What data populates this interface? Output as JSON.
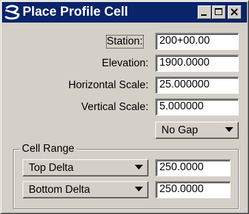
{
  "window": {
    "title": "Place Profile Cell",
    "icons": [
      "app-logo-icon",
      "minimize-icon",
      "maximize-icon",
      "close-icon"
    ]
  },
  "fields": {
    "station_label": "Station:",
    "station_value": "200+00.00",
    "elevation_label": "Elevation:",
    "elevation_value": "1900.0000",
    "horizontal_scale_label": "Horizontal Scale:",
    "horizontal_scale_value": "25.000000",
    "vertical_scale_label": "Vertical Scale:",
    "vertical_scale_value": "5.000000"
  },
  "gap_select": {
    "selected": "No Gap"
  },
  "cell_range": {
    "label": "Cell Range",
    "top_select": "Top Delta",
    "top_value": "250.0000",
    "bottom_select": "Bottom Delta",
    "bottom_value": "250.0000"
  },
  "colors": {
    "titlebar": "#0a246a",
    "face": "#d4d0c8",
    "field_background": "#ffffff"
  }
}
